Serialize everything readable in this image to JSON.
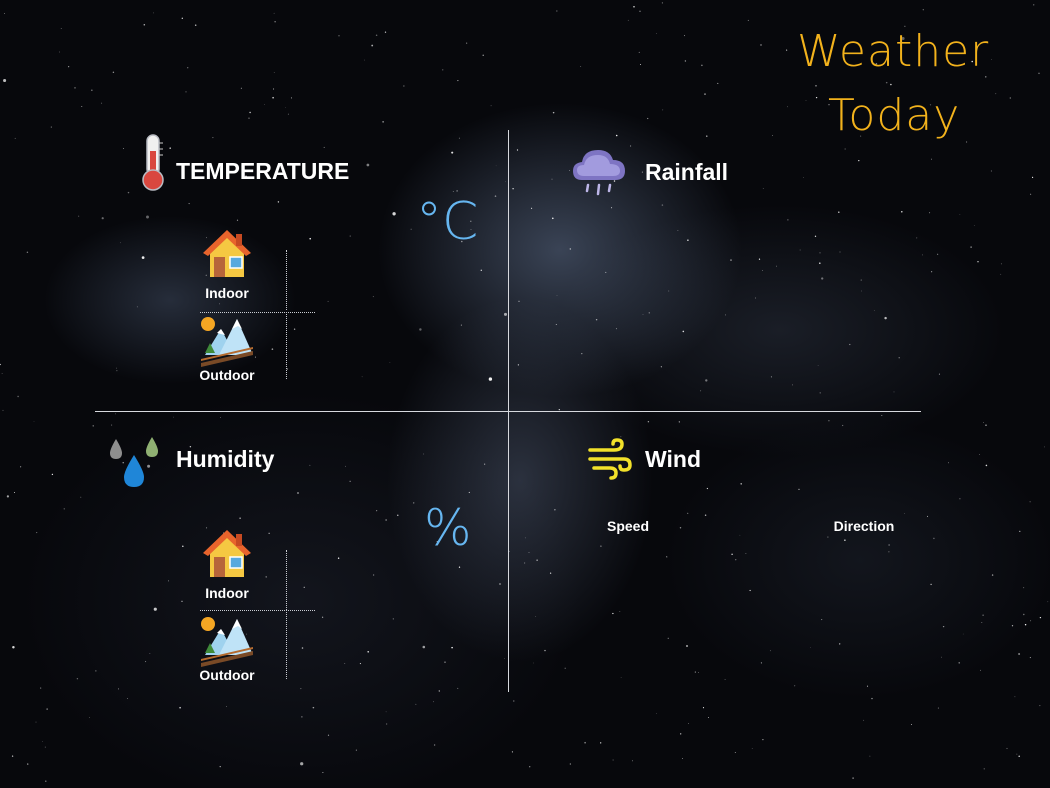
{
  "title": {
    "line1": "Weather",
    "line2": "Today"
  },
  "temperature": {
    "label": "TEMPERATURE",
    "unit": "°C",
    "indoor_label": "Indoor",
    "outdoor_label": "Outdoor"
  },
  "rainfall": {
    "label": "Rainfall"
  },
  "humidity": {
    "label": "Humidity",
    "unit": "%",
    "indoor_label": "Indoor",
    "outdoor_label": "Outdoor"
  },
  "wind": {
    "label": "Wind",
    "speed_label": "Speed",
    "direction_label": "Direction"
  },
  "icons": {
    "temperature": "thermometer-icon",
    "rainfall": "rain-cloud-icon",
    "humidity": "water-drops-icon",
    "wind": "wind-icon",
    "indoor": "house-icon",
    "outdoor": "mountain-landscape-icon"
  },
  "colors": {
    "title": "#f2b21c",
    "unit": "#66b6f0",
    "background": "#07080c",
    "divider": "#d7d9de"
  }
}
